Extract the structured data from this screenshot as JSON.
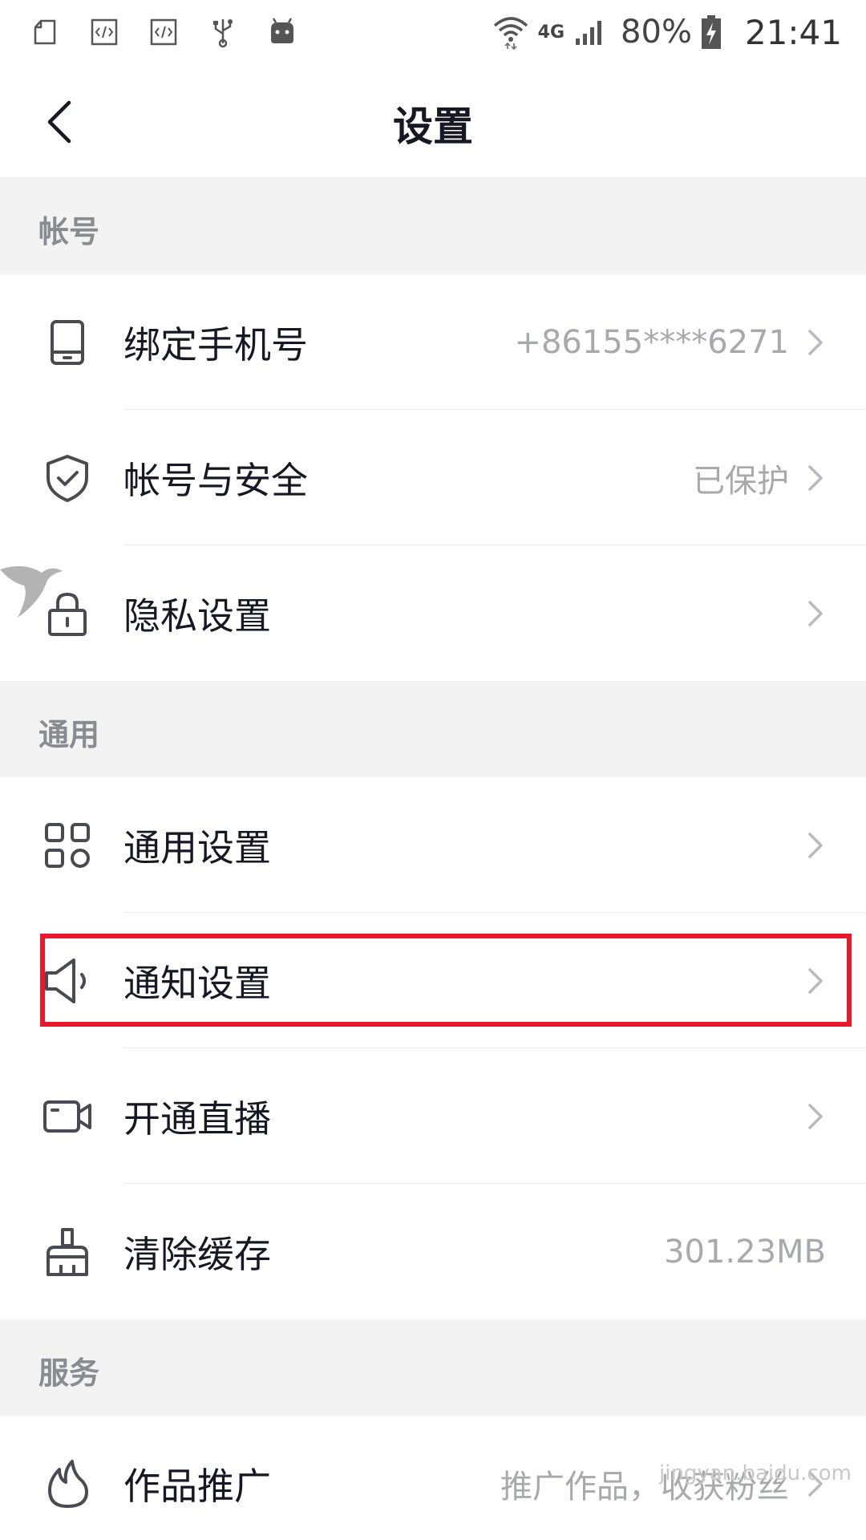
{
  "status_bar": {
    "battery": "80%",
    "network": "4G",
    "time": "21:41"
  },
  "header": {
    "title": "设置"
  },
  "sections": [
    {
      "title": "帐号",
      "items": [
        {
          "label": "绑定手机号",
          "value": "+86155****6271",
          "icon": "phone-icon"
        },
        {
          "label": "帐号与安全",
          "value": "已保护",
          "icon": "shield-check-icon"
        },
        {
          "label": "隐私设置",
          "value": "",
          "icon": "lock-icon"
        }
      ]
    },
    {
      "title": "通用",
      "items": [
        {
          "label": "通用设置",
          "value": "",
          "icon": "grid-icon"
        },
        {
          "label": "通知设置",
          "value": "",
          "icon": "speaker-icon"
        },
        {
          "label": "开通直播",
          "value": "",
          "icon": "video-camera-icon"
        },
        {
          "label": "清除缓存",
          "value": "301.23MB",
          "icon": "broom-icon"
        }
      ]
    },
    {
      "title": "服务",
      "items": [
        {
          "label": "作品推广",
          "value": "推广作品，收获粉丝",
          "icon": "flame-icon"
        }
      ]
    }
  ],
  "watermark": {
    "text": "jingyan.baidu.com",
    "logo": "bird-logo-icon"
  },
  "colors": {
    "highlight": "#e8192c",
    "section_bg": "#f3f3f4",
    "muted_text": "#a8a9ad"
  }
}
